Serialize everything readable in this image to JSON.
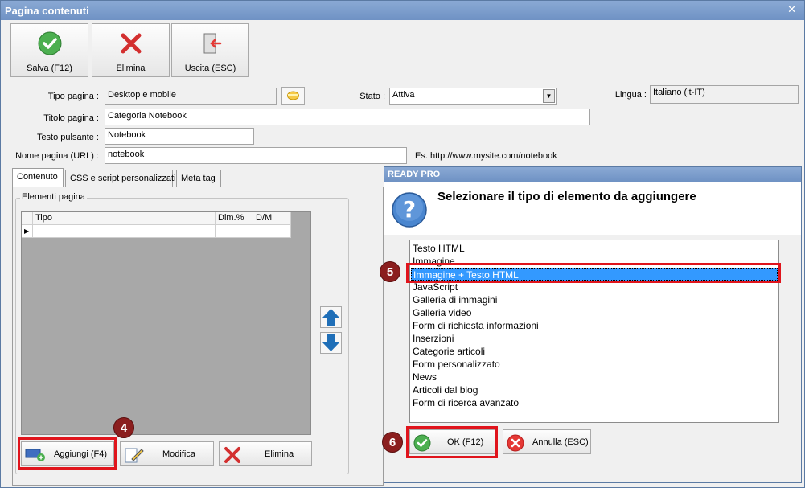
{
  "window": {
    "title": "Pagina contenuti",
    "close_glyph": "✕"
  },
  "toolbar": {
    "save_label": "Salva (F12)",
    "delete_label": "Elimina",
    "exit_label": "Uscita (ESC)"
  },
  "form": {
    "tipo_pagina_label": "Tipo pagina :",
    "tipo_pagina_value": "Desktop e mobile",
    "stato_label": "Stato :",
    "stato_value": "Attiva",
    "lingua_label": "Lingua :",
    "lingua_value": "Italiano (it-IT)",
    "titolo_label": "Titolo pagina :",
    "titolo_value": "Categoria Notebook",
    "testo_pulsante_label": "Testo pulsante :",
    "testo_pulsante_value": "Notebook",
    "nome_pagina_label": "Nome pagina (URL) :",
    "nome_pagina_value": "notebook",
    "url_hint": "Es. http://www.mysite.com/notebook"
  },
  "tabs": [
    {
      "label": "Contenuto"
    },
    {
      "label": "CSS e script personalizzati"
    },
    {
      "label": "Meta tag"
    }
  ],
  "elements_group": {
    "title": "Elementi pagina",
    "columns": [
      "Tipo",
      "Dim.%",
      "D/M"
    ],
    "row_indicator": "▶"
  },
  "bottom_buttons": {
    "add_label": "Aggiungi (F4)",
    "edit_label": "Modifica",
    "delete_label": "Elimina"
  },
  "callouts": {
    "c4": "4",
    "c5": "5",
    "c6": "6"
  },
  "dialog": {
    "title": "READY PRO",
    "prompt": "Selezionare il tipo di elemento da aggiungere",
    "items": [
      "Testo HTML",
      "Immagine",
      "Immagine + Testo HTML",
      "JavaScript",
      "Galleria di immagini",
      "Galleria video",
      "Form di richiesta informazioni",
      "Inserzioni",
      "Categorie articoli",
      "Form personalizzato",
      "News",
      "Articoli dal blog",
      "Form di ricerca avanzato"
    ],
    "selected_index": 2,
    "ok_label": "OK (F12)",
    "cancel_label": "Annulla (ESC)"
  },
  "colors": {
    "accent": "#6f92c4",
    "selection": "#3399ff",
    "highlight": "#e0141c",
    "callout": "#8b1e1e"
  }
}
